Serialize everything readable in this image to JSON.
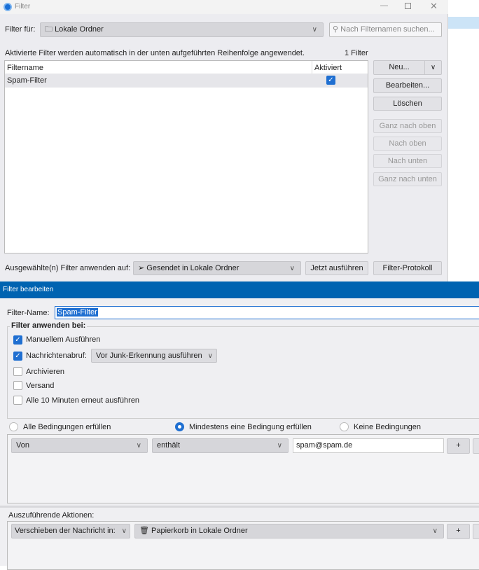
{
  "filter_window": {
    "title": "Filter",
    "filter_for_label": "Filter für:",
    "folder": "Lokale Ordner",
    "search_placeholder": "Nach Filternamen suchen...",
    "info_text": "Aktivierte Filter werden automatisch in der unten aufgeführten Reihenfolge angewendet.",
    "count": "1 Filter",
    "columns": [
      "Filtername",
      "Aktiviert"
    ],
    "rows": [
      {
        "name": "Spam-Filter",
        "enabled": true
      }
    ],
    "buttons": {
      "new": "Neu...",
      "edit": "Bearbeiten...",
      "delete": "Löschen",
      "top": "Ganz nach oben",
      "up": "Nach oben",
      "down": "Nach unten",
      "bottom": "Ganz nach unten"
    },
    "apply_label": "Ausgewählte(n) Filter anwenden auf:",
    "apply_folder": "Gesendet in Lokale Ordner",
    "run_now": "Jetzt ausführen",
    "log": "Filter-Protokoll"
  },
  "edit_window": {
    "title": "Filter bearbeiten",
    "name_label": "Filter-Name:",
    "name_value": "Spam-Filter",
    "apply_when": "Filter anwenden bei:",
    "options": [
      {
        "label": "Manuellem Ausführen",
        "checked": true
      },
      {
        "label": "Nachrichtenabruf:",
        "checked": true
      },
      {
        "label": "Archivieren",
        "checked": false
      },
      {
        "label": "Versand",
        "checked": false
      },
      {
        "label": "Alle 10 Minuten erneut ausführen",
        "checked": false
      }
    ],
    "fetch_timing": "Vor Junk-Erkennung ausführen",
    "match": [
      "Alle Bedingungen erfüllen",
      "Mindestens eine Bedingung erfüllen",
      "Keine Bedingungen"
    ],
    "match_selected": 1,
    "condition": {
      "field": "Von",
      "op": "enthält",
      "value": "spam@spam.de",
      "add": "+"
    },
    "actions_label": "Auszuführende Aktionen:",
    "action": {
      "type": "Verschieben der Nachricht in:",
      "target": "Papierkorb in Lokale Ordner",
      "add": "+"
    }
  }
}
